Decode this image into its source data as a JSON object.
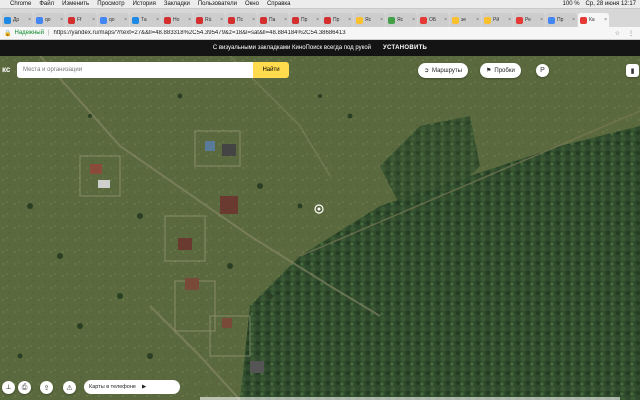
{
  "menubar": {
    "apple_icon": "apple-icon",
    "items": [
      "Chrome",
      "Файл",
      "Изменить",
      "Просмотр",
      "История",
      "Закладки",
      "Пользователи",
      "Окно",
      "Справка"
    ],
    "battery": "100 %",
    "datetime": "Ср, 28 июня 12:17"
  },
  "tabs": [
    {
      "label": "Др",
      "color": "#1e88e5"
    },
    {
      "label": "qo",
      "color": "#4285f4"
    },
    {
      "label": "Ff",
      "color": "#d32f2f"
    },
    {
      "label": "qo",
      "color": "#4285f4"
    },
    {
      "label": "Та",
      "color": "#1e88e5"
    },
    {
      "label": "Но",
      "color": "#d32f2f"
    },
    {
      "label": "Rü",
      "color": "#d32f2f"
    },
    {
      "label": "Пс",
      "color": "#d32f2f"
    },
    {
      "label": "Па",
      "color": "#d32f2f"
    },
    {
      "label": "Пр",
      "color": "#d32f2f"
    },
    {
      "label": "Пр",
      "color": "#d32f2f"
    },
    {
      "label": "Яс",
      "color": "#fbc02d"
    },
    {
      "label": "Яс",
      "color": "#43a047"
    },
    {
      "label": "ОБ",
      "color": "#e53935"
    },
    {
      "label": "зе",
      "color": "#fbc02d"
    },
    {
      "label": "Рй",
      "color": "#fbc02d"
    },
    {
      "label": "Ре",
      "color": "#e53935"
    },
    {
      "label": "Пр",
      "color": "#4285f4"
    },
    {
      "label": "Ка",
      "color": "#e53935",
      "active": true
    }
  ],
  "address": {
    "secure_label": "Надежный",
    "url": "https://yandex.ru/maps/?rtext=27&&ll=48.883318%2C54.395479&z=18&l=sat&ll=48.884184%2C54.38686413"
  },
  "promo": {
    "text": "С визуальными закладками КиноПоиск всегда под рукой",
    "install_label": "УСТАНОВИТЬ"
  },
  "map": {
    "logo_fragment": "кс",
    "search_placeholder": "Места и организации",
    "find_label": "Найти",
    "routes_label": "Маршруты",
    "traffic_label": "Пробки",
    "apps_label": "Карты в телефоне",
    "colors": {
      "field": "#5b6a3e",
      "forest": "#2f4a2c",
      "road": "#8a8a6a",
      "accent": "#ffdb4d"
    }
  }
}
